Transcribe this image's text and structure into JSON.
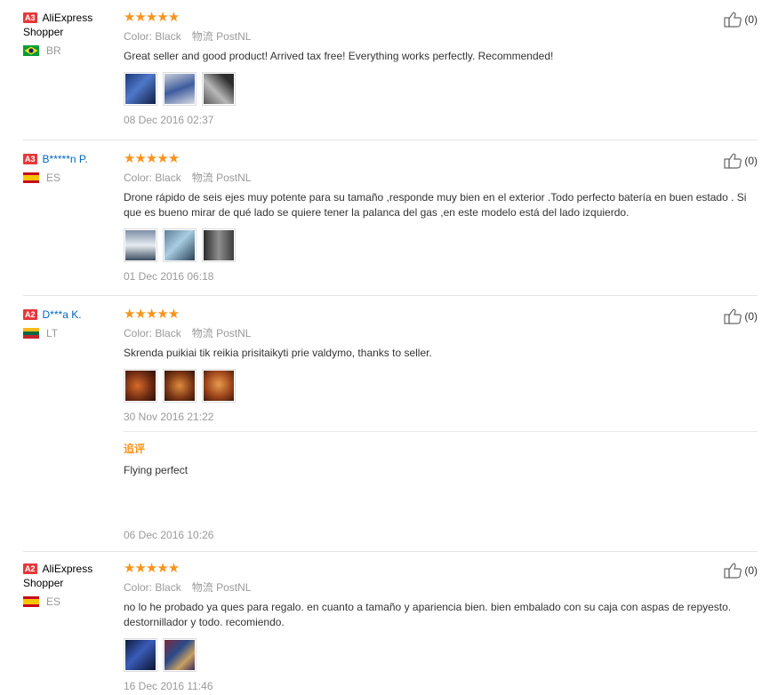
{
  "labels": {
    "color": "Color:",
    "logistics": "物流"
  },
  "reviews": [
    {
      "level": "A3",
      "name_line1": "AliExpress",
      "name_line2": "Shopper",
      "country": "BR",
      "stars": "★★★★★",
      "color": "Black",
      "logistics": "PostNL",
      "text": "Great seller and good product! Arrived tax free! Everything works perfectly. Recommended!",
      "date": "08 Dec 2016 02:37",
      "likes": "(0)"
    },
    {
      "level": "A3",
      "name_line1": "B*****n P.",
      "country": "ES",
      "stars": "★★★★★",
      "color": "Black",
      "logistics": "PostNL",
      "text": "Drone rápido de seis ejes muy potente para su tamaño ,responde muy bien en el exterior .Todo perfecto batería en buen estado . Si que es bueno mirar de qué lado se quiere tener la palanca del gas ,en este modelo está del lado izquierdo.",
      "date": "01 Dec 2016 06:18",
      "likes": "(0)"
    },
    {
      "level": "A2",
      "name_line1": "D***a K.",
      "country": "LT",
      "stars": "★★★★★",
      "color": "Black",
      "logistics": "PostNL",
      "text": "Skrenda puikiai tik reikia prisitaikyti prie valdymo, thanks to seller.",
      "date": "30 Nov 2016 21:22",
      "followup_label": "追评",
      "followup_text": "Flying perfect",
      "followup_date": "06 Dec 2016 10:26",
      "likes": "(0)"
    },
    {
      "level": "A2",
      "name_line1": "AliExpress",
      "name_line2": "Shopper",
      "country": "ES",
      "stars": "★★★★★",
      "color": "Black",
      "logistics": "PostNL",
      "text": "no lo he probado ya ques para regalo. en cuanto a tamaño y apariencia bien. bien embalado con su caja con aspas de repyesto. destornillador y todo. recomiendo.",
      "date": "16 Dec 2016 11:46",
      "likes": "(0)"
    }
  ],
  "colors": {
    "star": "#f7941d",
    "level_badge": "#e4393c",
    "link": "#0066c0",
    "muted": "#999999"
  }
}
